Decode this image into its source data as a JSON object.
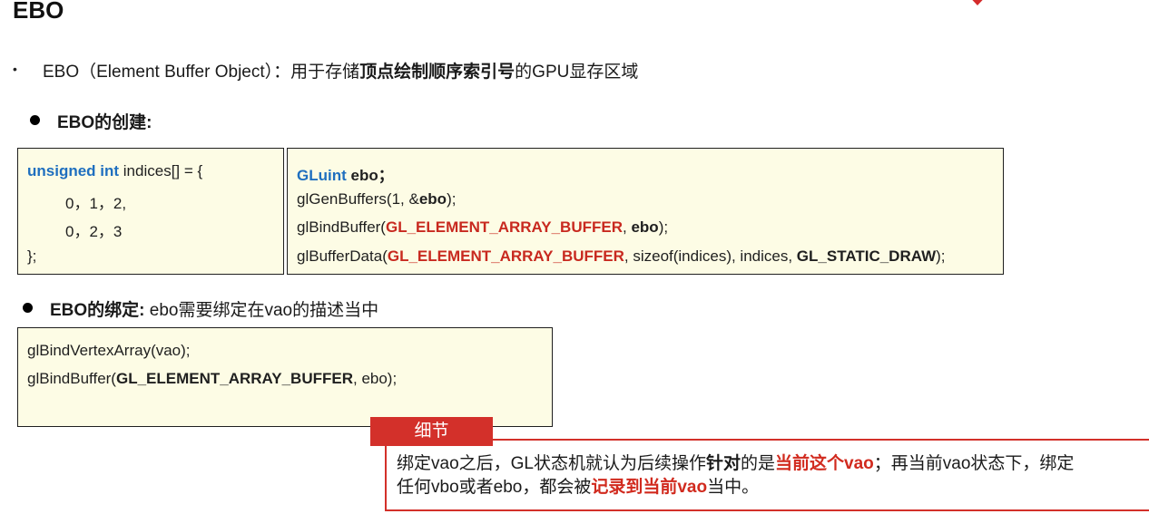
{
  "page": {
    "title": "EBO"
  },
  "definition": {
    "bullet": "•",
    "prefix": "EBO（Element Buffer Object）：用于存储",
    "bold": "顶点绘制顺序索引号",
    "suffix": "的GPU显存区域"
  },
  "creation": {
    "heading": "EBO的创建:",
    "indices_box": {
      "line1_type": "unsigned int",
      "line1_rest": " indices[] = {",
      "line2": "0，1，2,",
      "line3": "0，2，3",
      "line4": "};"
    },
    "gl_box": {
      "l1_type": "GLuint",
      "l1_name": " ebo",
      "l1_end": "；",
      "l2_a": "glGenBuffers(1, &",
      "l2_b": "ebo",
      "l2_c": ");",
      "l3_a": "glBindBuffer(",
      "l3_b": "GL_ELEMENT_ARRAY_BUFFER",
      "l3_c": ", ",
      "l3_d": "ebo",
      "l3_e": ");",
      "l4_a": "glBufferData(",
      "l4_b": "GL_ELEMENT_ARRAY_BUFFER",
      "l4_c": ", sizeof(indices), indices, ",
      "l4_d": "GL_STATIC_DRAW",
      "l4_e": ");"
    }
  },
  "binding": {
    "heading_bold": "EBO的绑定:",
    "heading_rest": " ebo需要绑定在vao的描述当中",
    "code": {
      "l1": "glBindVertexArray(vao);",
      "l2_a": "glBindBuffer(",
      "l2_b": "GL_ELEMENT_ARRAY_BUFFER",
      "l2_c": ", ebo);"
    }
  },
  "note": {
    "tag": "细节",
    "t1": "绑定vao之后，GL状态机就认为后续操作",
    "t2": "针对",
    "t3": "的是",
    "t4": "当前这个vao",
    "t5": "；再当前vao状态下，绑定",
    "t6": "任何vbo或者ebo，都会被",
    "t7": "记录到当前vao",
    "t8": "当中。"
  },
  "colors": {
    "accent_red": "#d3302a",
    "keyword_blue": "#1f6fbf",
    "code_bg": "#fdfce5"
  }
}
